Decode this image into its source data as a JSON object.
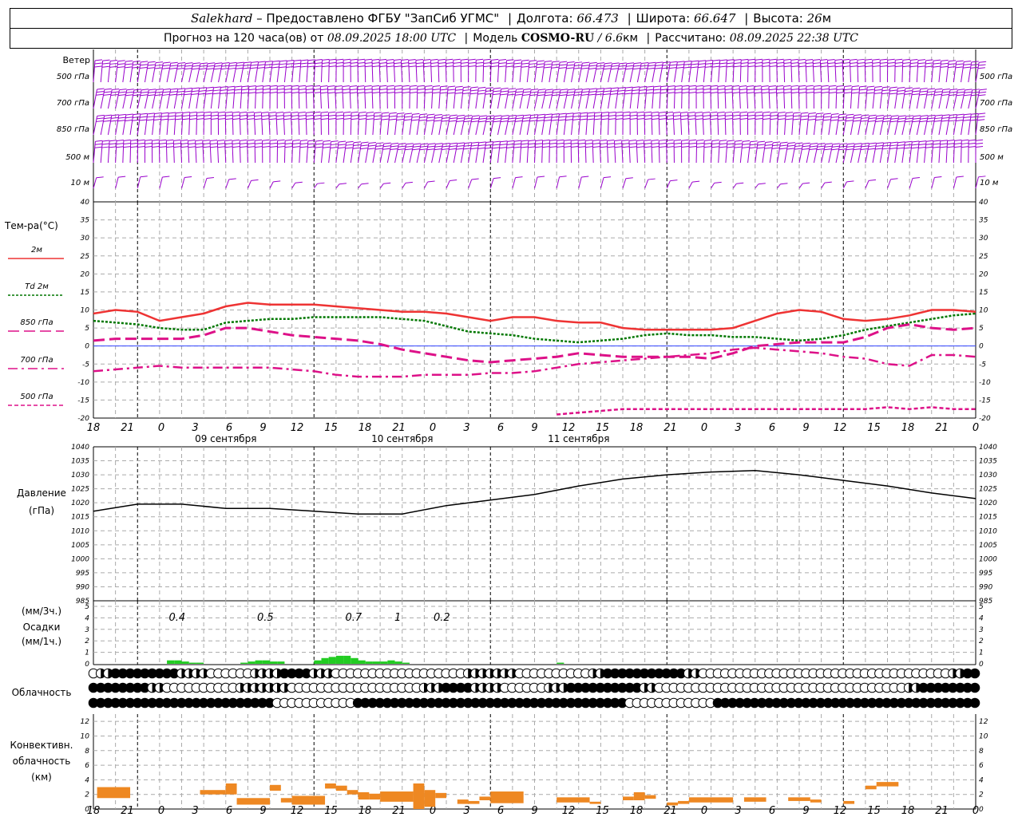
{
  "header": {
    "station": "Salekhard",
    "provided": "– Предоставлено ФГБУ \"ЗапСиб УГМС\"",
    "lon_label": "Долгота:",
    "lon": "66.473",
    "lat_label": "Широта:",
    "lat": "66.647",
    "alt_label": "Высота:",
    "alt": "26",
    "alt_unit": "м",
    "forecast_label": "Прогноз на 120 часа(ов) от",
    "forecast_start": "08.09.2025 18:00 UTC",
    "model_label": "Модель",
    "model": "COSMO-RU",
    "model_res": "/ 6.6",
    "model_res_unit": "км",
    "calc_label": "Рассчитано:",
    "calc_time": "08.09.2025 22:38 UTC"
  },
  "wind_panel": {
    "title": "Ветер",
    "levels": [
      "500 гПа",
      "700 гПа",
      "850 гПа",
      "500 м",
      "10  м"
    ],
    "color": "#9900cc"
  },
  "temp_panel": {
    "title": "Тем-ра(°C)",
    "legend": [
      {
        "label": "2м",
        "color": "#ee3333",
        "style": "solid"
      },
      {
        "label": "Td  2м",
        "color": "#007700",
        "style": "dotted"
      },
      {
        "label": "850 гПа",
        "color": "#dd1188",
        "style": "longdash"
      },
      {
        "label": "700 гПа",
        "color": "#dd1188",
        "style": "dashdot"
      },
      {
        "label": "500 гПа",
        "color": "#dd1188",
        "style": "shortdash"
      }
    ],
    "yticks": [
      "40",
      "35",
      "30",
      "25",
      "20",
      "15",
      "10",
      "5",
      "0",
      "-5",
      "-10",
      "-15",
      "-20"
    ]
  },
  "x_axis": {
    "hour_labels": [
      "18",
      "21",
      "0",
      "3",
      "6",
      "9",
      "12",
      "15",
      "18",
      "21",
      "0",
      "3",
      "6",
      "9",
      "12",
      "15",
      "18",
      "21",
      "0",
      "3",
      "6",
      "9",
      "12",
      "15",
      "18",
      "21",
      "0"
    ],
    "day_labels": [
      "09 сентября",
      "10 сентября",
      "11 сентября"
    ]
  },
  "pressure_panel": {
    "title": "Давление",
    "unit": "(гПа)",
    "yticks": [
      "1040",
      "1035",
      "1030",
      "1025",
      "1020",
      "1015",
      "1010",
      "1005",
      "1000",
      "995",
      "990",
      "985"
    ]
  },
  "precip_panel": {
    "unit_3h": "(мм/3ч.)",
    "title": "Осадки",
    "unit_1h": "(мм/1ч.)",
    "yticks": [
      "5",
      "4",
      "3",
      "2",
      "1",
      "0"
    ],
    "totals": [
      "0.4",
      "0.5",
      "0.7",
      "1",
      "0.2"
    ],
    "color": "#22cc22"
  },
  "cloud_panel": {
    "title": "Облачность"
  },
  "conv_panel": {
    "title_1": "Конвективн.",
    "title_2": "облачность",
    "unit": "(км)",
    "yticks": [
      "12",
      "10",
      "8",
      "6",
      "4",
      "2",
      "0"
    ],
    "color": "#ee8822"
  },
  "chart_data": [
    {
      "type": "line",
      "name": "temperature",
      "x_hours": [
        0,
        3,
        6,
        9,
        12,
        15,
        18,
        21,
        24,
        27,
        30,
        33,
        36,
        39,
        42,
        45,
        48,
        51,
        54,
        57,
        60,
        63,
        66,
        69,
        72,
        75,
        78,
        81,
        84,
        87,
        90,
        93,
        96,
        99,
        102,
        105,
        108,
        111,
        114,
        117,
        120
      ],
      "ylim": [
        -20,
        40
      ],
      "series": [
        {
          "name": "2м",
          "values": [
            9,
            10,
            9.5,
            7,
            8,
            9,
            11,
            12,
            11.5,
            11.5,
            11.5,
            11,
            10.5,
            10,
            9.5,
            9.5,
            9,
            8,
            7,
            8,
            8,
            7,
            6.5,
            6.5,
            5,
            4.5,
            4.5,
            4.5,
            4.5,
            5,
            7,
            9,
            10,
            9.5,
            7.5,
            7,
            7.5,
            8.5,
            10,
            10,
            9.5
          ]
        },
        {
          "name": "Td 2м",
          "values": [
            7,
            6.5,
            6,
            5,
            4.5,
            4.5,
            6.5,
            7,
            7.5,
            7.5,
            8,
            8,
            8,
            8,
            7.5,
            7,
            5.5,
            4,
            3.5,
            3,
            2,
            1.5,
            1,
            1.5,
            2,
            3,
            3.5,
            3,
            3,
            2.5,
            2.5,
            2,
            1.5,
            2,
            3,
            4.5,
            5.5,
            6.5,
            7.5,
            8.5,
            9
          ]
        },
        {
          "name": "850 гПа",
          "values": [
            1.5,
            2,
            2,
            2,
            2,
            3,
            5,
            5,
            4,
            3,
            2.5,
            2,
            1.5,
            0.5,
            -1,
            -2,
            -3,
            -4,
            -4.5,
            -4,
            -3.5,
            -3,
            -2,
            -2.5,
            -3,
            -3,
            -3,
            -3,
            -3.5,
            -2,
            0,
            0.5,
            1,
            1,
            1,
            2.5,
            5,
            6,
            5,
            4.5,
            5
          ]
        },
        {
          "name": "700 гПа",
          "values": [
            -7,
            -6.5,
            -6,
            -5.5,
            -6,
            -6,
            -6,
            -6,
            -6,
            -6.5,
            -7,
            -8,
            -8.5,
            -8.5,
            -8.5,
            -8,
            -8,
            -8,
            -7.5,
            -7.5,
            -7,
            -6,
            -5,
            -4.5,
            -4,
            -3.5,
            -3,
            -2.5,
            -2,
            -1,
            -0.5,
            -1,
            -1.5,
            -2,
            -3,
            -3.5,
            -5,
            -5.5,
            -2.5,
            -2.5,
            -3
          ]
        },
        {
          "name": "500 гПа",
          "values": [
            null,
            null,
            null,
            null,
            null,
            null,
            null,
            null,
            null,
            null,
            null,
            null,
            null,
            null,
            null,
            null,
            null,
            null,
            null,
            null,
            null,
            -19,
            -18.5,
            -18,
            -17.5,
            -17.5,
            -17.5,
            -17.5,
            -17.5,
            -17.5,
            -17.5,
            -17.5,
            -17.5,
            -17.5,
            -17.5,
            -17.5,
            -17,
            -17.5,
            -17,
            -17.5,
            -17.5
          ]
        }
      ]
    },
    {
      "type": "line",
      "name": "pressure",
      "ylim": [
        985,
        1040
      ],
      "x_hours": [
        0,
        6,
        12,
        18,
        24,
        30,
        36,
        42,
        48,
        54,
        60,
        66,
        72,
        78,
        84,
        90,
        96,
        102,
        108,
        114,
        120
      ],
      "values": [
        1017,
        1019.5,
        1019.5,
        1018,
        1018,
        1017,
        1016,
        1016,
        1019,
        1021,
        1023,
        1026,
        1028.5,
        1030,
        1031,
        1031.5,
        1030,
        1028,
        1026,
        1023.5,
        1021.5
      ]
    },
    {
      "type": "bar",
      "name": "precipitation_1h",
      "ylim": [
        0,
        5
      ],
      "x_hours": [
        10,
        11,
        12,
        13,
        14,
        15,
        20,
        21,
        22,
        23,
        24,
        25,
        30,
        31,
        32,
        33,
        34,
        35,
        36,
        37,
        38,
        39,
        40,
        41,
        42,
        43,
        44,
        45,
        46,
        47,
        48,
        49,
        50,
        51,
        52,
        53,
        54,
        55,
        56,
        57,
        58,
        59,
        60,
        61,
        62,
        63
      ],
      "values": [
        0.3,
        0.3,
        0.2,
        0.1,
        0.1,
        0,
        0.1,
        0.2,
        0.3,
        0.3,
        0.2,
        0.2,
        0.3,
        0.5,
        0.6,
        0.7,
        0.7,
        0.5,
        0.3,
        0.2,
        0.2,
        0.2,
        0.3,
        0.2,
        0.1,
        0,
        0,
        0,
        0,
        0,
        0,
        0,
        0,
        0,
        0,
        0,
        0,
        0,
        0,
        0,
        0,
        0,
        0,
        0,
        0,
        0.1
      ]
    },
    {
      "type": "bar",
      "name": "convective_cloud",
      "ylim": [
        0,
        13
      ],
      "segments": [
        {
          "from": 0.5,
          "to": 5,
          "base": 1.5,
          "top": 3
        },
        {
          "from": 14.5,
          "to": 18,
          "base": 2,
          "top": 2.6
        },
        {
          "from": 18,
          "to": 19.5,
          "base": 2,
          "top": 3.5
        },
        {
          "from": 19.5,
          "to": 24,
          "base": 0.6,
          "top": 1.5
        },
        {
          "from": 24,
          "to": 25.5,
          "base": 2.5,
          "top": 3.3
        },
        {
          "from": 25.5,
          "to": 27,
          "base": 0.9,
          "top": 1.5
        },
        {
          "from": 27,
          "to": 31.5,
          "base": 0.6,
          "top": 1.8
        },
        {
          "from": 31.5,
          "to": 33,
          "base": 2.8,
          "top": 3.5
        },
        {
          "from": 33,
          "to": 34.5,
          "base": 2.5,
          "top": 3.2
        },
        {
          "from": 34.5,
          "to": 36,
          "base": 2,
          "top": 2.6
        },
        {
          "from": 36,
          "to": 37.5,
          "base": 1.3,
          "top": 2.3
        },
        {
          "from": 37.5,
          "to": 39,
          "base": 1.3,
          "top": 2.1
        },
        {
          "from": 39,
          "to": 43.5,
          "base": 1,
          "top": 2.4
        },
        {
          "from": 43.5,
          "to": 45,
          "base": 0,
          "top": 3.5
        },
        {
          "from": 45,
          "to": 46.5,
          "base": 0.3,
          "top": 2.6
        },
        {
          "from": 46.5,
          "to": 48,
          "base": 1.5,
          "top": 2.2
        },
        {
          "from": 49.5,
          "to": 51,
          "base": 0.7,
          "top": 1.3
        },
        {
          "from": 51,
          "to": 52.5,
          "base": 0.7,
          "top": 1.1
        },
        {
          "from": 52.5,
          "to": 54,
          "base": 1.2,
          "top": 1.7
        },
        {
          "from": 54,
          "to": 58.5,
          "base": 0.8,
          "top": 2.4
        },
        {
          "from": 63,
          "to": 67.5,
          "base": 0.9,
          "top": 1.6
        },
        {
          "from": 67.5,
          "to": 69,
          "base": 0.7,
          "top": 1
        },
        {
          "from": 72,
          "to": 73.5,
          "base": 1.2,
          "top": 1.7
        },
        {
          "from": 73.5,
          "to": 75,
          "base": 1.2,
          "top": 2.3
        },
        {
          "from": 75,
          "to": 76.5,
          "base": 1.4,
          "top": 1.9
        },
        {
          "from": 78,
          "to": 79.5,
          "base": 0.5,
          "top": 0.9
        },
        {
          "from": 79.5,
          "to": 81,
          "base": 0.7,
          "top": 1.1
        },
        {
          "from": 81,
          "to": 87,
          "base": 0.9,
          "top": 1.6
        },
        {
          "from": 88.5,
          "to": 91.5,
          "base": 1,
          "top": 1.6
        },
        {
          "from": 94.5,
          "to": 97.5,
          "base": 1.1,
          "top": 1.6
        },
        {
          "from": 97.5,
          "to": 99,
          "base": 0.9,
          "top": 1.3
        },
        {
          "from": 102,
          "to": 103.5,
          "base": 0.7,
          "top": 1.1
        },
        {
          "from": 105,
          "to": 106.5,
          "base": 2.7,
          "top": 3.2
        },
        {
          "from": 106.5,
          "to": 109.5,
          "base": 3.1,
          "top": 3.7
        }
      ]
    }
  ]
}
